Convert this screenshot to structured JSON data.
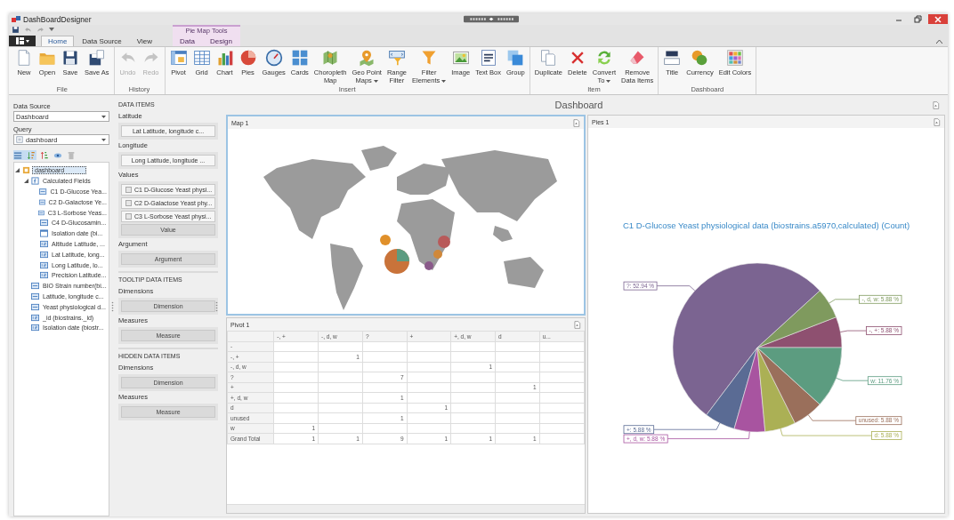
{
  "window": {
    "title": "DashBoardDesigner"
  },
  "ribbon": {
    "contextual_group": "Pie Map Tools",
    "tabs": [
      {
        "label": "Home",
        "selected": true,
        "contextual": false
      },
      {
        "label": "Data Source",
        "selected": false,
        "contextual": false
      },
      {
        "label": "View",
        "selected": false,
        "contextual": false
      },
      {
        "label": "Data",
        "selected": false,
        "contextual": true
      },
      {
        "label": "Design",
        "selected": false,
        "contextual": true
      }
    ],
    "groups": [
      {
        "name": "File",
        "buttons": [
          {
            "label": "New",
            "disabled": false,
            "menu": false
          },
          {
            "label": "Open",
            "disabled": false,
            "menu": false
          },
          {
            "label": "Save",
            "disabled": false,
            "menu": false
          },
          {
            "label": "Save As",
            "disabled": false,
            "menu": false
          }
        ]
      },
      {
        "name": "History",
        "buttons": [
          {
            "label": "Undo",
            "disabled": true,
            "menu": false
          },
          {
            "label": "Redo",
            "disabled": true,
            "menu": false
          }
        ]
      },
      {
        "name": "Insert",
        "buttons": [
          {
            "label": "Pivot",
            "disabled": false,
            "menu": false
          },
          {
            "label": "Grid",
            "disabled": false,
            "menu": false
          },
          {
            "label": "Chart",
            "disabled": false,
            "menu": false
          },
          {
            "label": "Pies",
            "disabled": false,
            "menu": false
          },
          {
            "label": "Gauges",
            "disabled": false,
            "menu": false
          },
          {
            "label": "Cards",
            "disabled": false,
            "menu": false
          },
          {
            "label": "Choropleth\nMap",
            "disabled": false,
            "menu": false
          },
          {
            "label": "Geo Point\nMaps",
            "disabled": false,
            "menu": true
          },
          {
            "label": "Range\nFilter",
            "disabled": false,
            "menu": false
          },
          {
            "label": "Filter\nElements",
            "disabled": false,
            "menu": true
          },
          {
            "label": "Image",
            "disabled": false,
            "menu": false
          },
          {
            "label": "Text Box",
            "disabled": false,
            "menu": false
          },
          {
            "label": "Group",
            "disabled": false,
            "menu": false
          }
        ]
      },
      {
        "name": "Item",
        "buttons": [
          {
            "label": "Duplicate",
            "disabled": false,
            "menu": false
          },
          {
            "label": "Delete",
            "disabled": false,
            "menu": false
          },
          {
            "label": "Convert\nTo",
            "disabled": false,
            "menu": true
          },
          {
            "label": "Remove\nData Items",
            "disabled": false,
            "menu": false
          }
        ]
      },
      {
        "name": "Dashboard",
        "buttons": [
          {
            "label": "Title",
            "disabled": false,
            "menu": false
          },
          {
            "label": "Currency",
            "disabled": false,
            "menu": false
          },
          {
            "label": "Edit Colors",
            "disabled": false,
            "menu": false
          }
        ]
      }
    ]
  },
  "data_source": {
    "label": "Data Source",
    "value": "Dashboard"
  },
  "query": {
    "label": "Query",
    "value": "dashboard"
  },
  "field_tree": [
    {
      "label": "dashboard",
      "kind": "source",
      "selected": true,
      "expanded": true,
      "children": [
        {
          "label": "Calculated Fields",
          "kind": "folder",
          "selected": false,
          "expanded": true,
          "children": [
            {
              "label": "C1 D-Glucose Yea...",
              "kind": "text",
              "selected": false
            },
            {
              "label": "C2 D-Galactose Ye...",
              "kind": "text",
              "selected": false
            },
            {
              "label": "C3 L-Sorbose Yeas...",
              "kind": "text",
              "selected": false
            },
            {
              "label": "C4 D-Glucosamin...",
              "kind": "text",
              "selected": false
            },
            {
              "label": "Isolation date (bi...",
              "kind": "date",
              "selected": false
            },
            {
              "label": "Altitude Latitude, ...",
              "kind": "number",
              "selected": false
            },
            {
              "label": "Lat Latitude, long...",
              "kind": "number",
              "selected": false
            },
            {
              "label": "Long Latitude, lo...",
              "kind": "number",
              "selected": false
            },
            {
              "label": "Precision Latitude...",
              "kind": "number",
              "selected": false
            }
          ]
        },
        {
          "label": "BIO Strain number(bi...",
          "kind": "text",
          "selected": false
        },
        {
          "label": "Latitude, longitude c...",
          "kind": "text",
          "selected": false
        },
        {
          "label": "Yeast physiological d...",
          "kind": "text",
          "selected": false
        },
        {
          "label": "_id (biostrains._id)",
          "kind": "number",
          "selected": false
        },
        {
          "label": "Isolation date (biostr...",
          "kind": "number",
          "selected": false
        }
      ]
    }
  ],
  "item_panels": [
    {
      "title": "DATA ITEMS",
      "sections": [
        {
          "label": "Latitude",
          "items": [
            {
              "kind": "field",
              "label": "Lat Latitude, longitude c..."
            }
          ]
        },
        {
          "label": "Longitude",
          "items": [
            {
              "kind": "field",
              "label": "Long Latitude, longitude ..."
            }
          ]
        },
        {
          "label": "Values",
          "items": [
            {
              "kind": "measure",
              "label": "C1 D-Glucose Yeast physi..."
            },
            {
              "kind": "measure",
              "label": "C2 D-Galactose Yeast phy..."
            },
            {
              "kind": "measure",
              "label": "C3 L-Sorbose Yeast physi..."
            },
            {
              "kind": "placeholder",
              "label": "Value"
            }
          ]
        },
        {
          "label": "Argument",
          "items": [
            {
              "kind": "placeholder",
              "label": "Argument"
            }
          ]
        }
      ]
    },
    {
      "title": "TOOLTIP DATA ITEMS",
      "sections": [
        {
          "label": "Dimensions",
          "items": [
            {
              "kind": "placeholder",
              "label": "Dimension"
            }
          ]
        },
        {
          "label": "Measures",
          "items": [
            {
              "kind": "placeholder",
              "label": "Measure"
            }
          ]
        }
      ]
    },
    {
      "title": "HIDDEN DATA ITEMS",
      "sections": [
        {
          "label": "Dimensions",
          "items": [
            {
              "kind": "placeholder",
              "label": "Dimension"
            }
          ]
        },
        {
          "label": "Measures",
          "items": [
            {
              "kind": "placeholder",
              "label": "Measure"
            }
          ]
        }
      ]
    }
  ],
  "dashboard": {
    "title": "Dashboard",
    "map": {
      "caption": "Map 1",
      "selected": true
    },
    "pivot": {
      "caption": "Pivot 1",
      "selected": false,
      "columns": [
        "-, +",
        "-, d, w",
        "?",
        "+",
        "+, d, w",
        "d",
        "u..."
      ],
      "rows": [
        {
          "label": "-",
          "cells": [
            null,
            null,
            null,
            null,
            null,
            null,
            null
          ]
        },
        {
          "label": "-, +",
          "cells": [
            null,
            "1",
            null,
            null,
            null,
            null,
            null
          ]
        },
        {
          "label": "-, d, w",
          "cells": [
            null,
            null,
            null,
            null,
            "1",
            null,
            null
          ]
        },
        {
          "label": "?",
          "cells": [
            null,
            null,
            "7",
            null,
            null,
            null,
            null
          ]
        },
        {
          "label": "+",
          "cells": [
            null,
            null,
            null,
            null,
            null,
            "1",
            null
          ]
        },
        {
          "label": "+, d, w",
          "cells": [
            null,
            null,
            "1",
            null,
            null,
            null,
            null
          ]
        },
        {
          "label": "d",
          "cells": [
            null,
            null,
            null,
            "1",
            null,
            null,
            null
          ]
        },
        {
          "label": "unused",
          "cells": [
            null,
            null,
            "1",
            null,
            null,
            null,
            null
          ]
        },
        {
          "label": "w",
          "cells": [
            "1",
            null,
            null,
            null,
            null,
            null,
            null
          ]
        },
        {
          "label": "Grand Total",
          "cells": [
            "1",
            "1",
            "9",
            "1",
            "1",
            "1",
            null
          ]
        }
      ]
    },
    "pie": {
      "caption": "Pies 1",
      "selected": false,
      "chart_data": {
        "type": "pie",
        "title": "C1 D-Glucose Yeast physiological data (biostrains.a5970,calculated) (Count)",
        "values": [
          5.88,
          5.88,
          52.94,
          5.88,
          5.88,
          5.88,
          5.88,
          11.76
        ],
        "value_labels": [
          "-, +: 5.88 %",
          "-, d, w: 5.88 %",
          "?: 52.94 %",
          "+: 5.88 %",
          "+, d, w: 5.88 %",
          "d: 5.88 %",
          "unused: 5.88 %",
          "w: 11.76 %"
        ]
      }
    }
  }
}
